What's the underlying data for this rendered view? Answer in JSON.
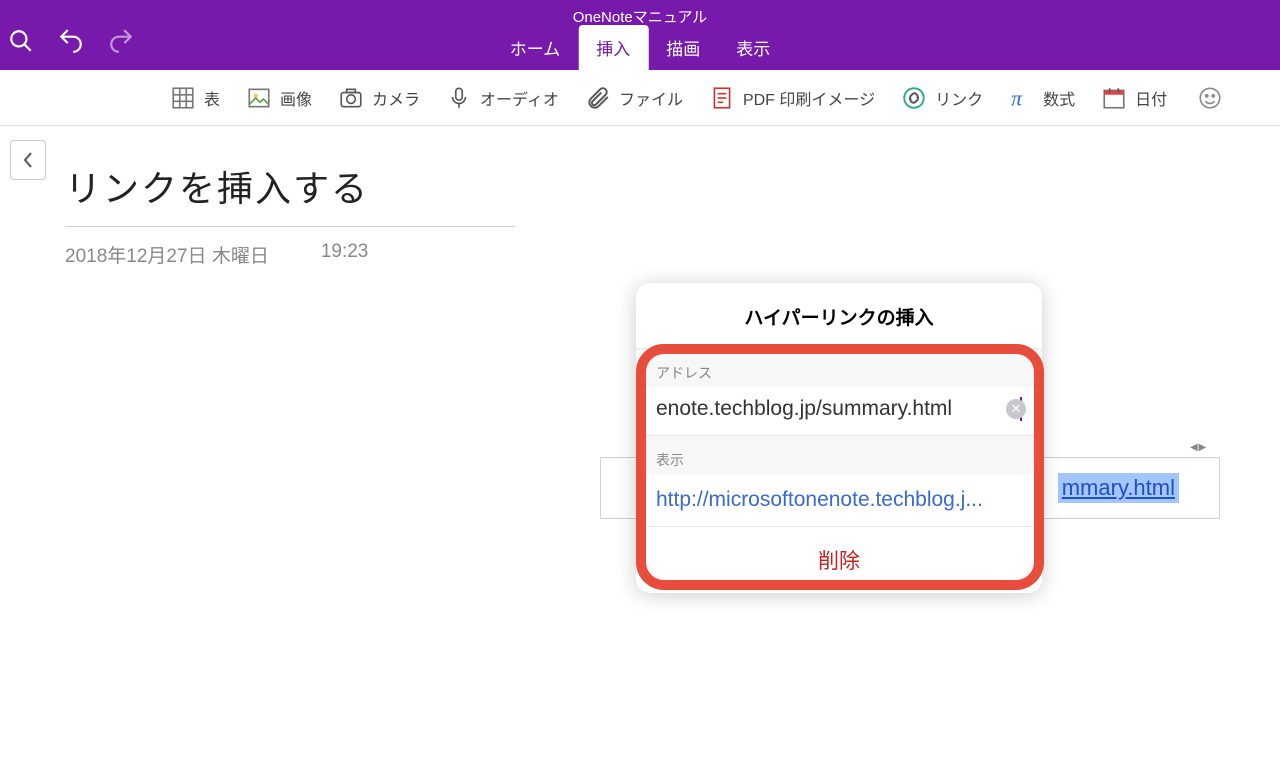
{
  "app": {
    "title": "OneNoteマニュアル"
  },
  "tabs": {
    "home": "ホーム",
    "insert": "挿入",
    "draw": "描画",
    "view": "表示"
  },
  "ribbon": {
    "table": "表",
    "image": "画像",
    "camera": "カメラ",
    "audio": "オーディオ",
    "file": "ファイル",
    "pdf": "PDF 印刷イメージ",
    "link": "リンク",
    "equation": "数式",
    "date": "日付"
  },
  "page": {
    "title": "リンクを挿入する",
    "date": "2018年12月27日 木曜日",
    "time": "19:23"
  },
  "textline": {
    "right_visible": "mmary.html"
  },
  "scroll_hint": "◀ ▶",
  "popover": {
    "title": "ハイパーリンクの挿入",
    "address_label": "アドレス",
    "address_value": "enote.techblog.jp/summary.html",
    "display_label": "表示",
    "display_value": "http://microsoftonenote.techblog.j...",
    "delete": "削除"
  }
}
